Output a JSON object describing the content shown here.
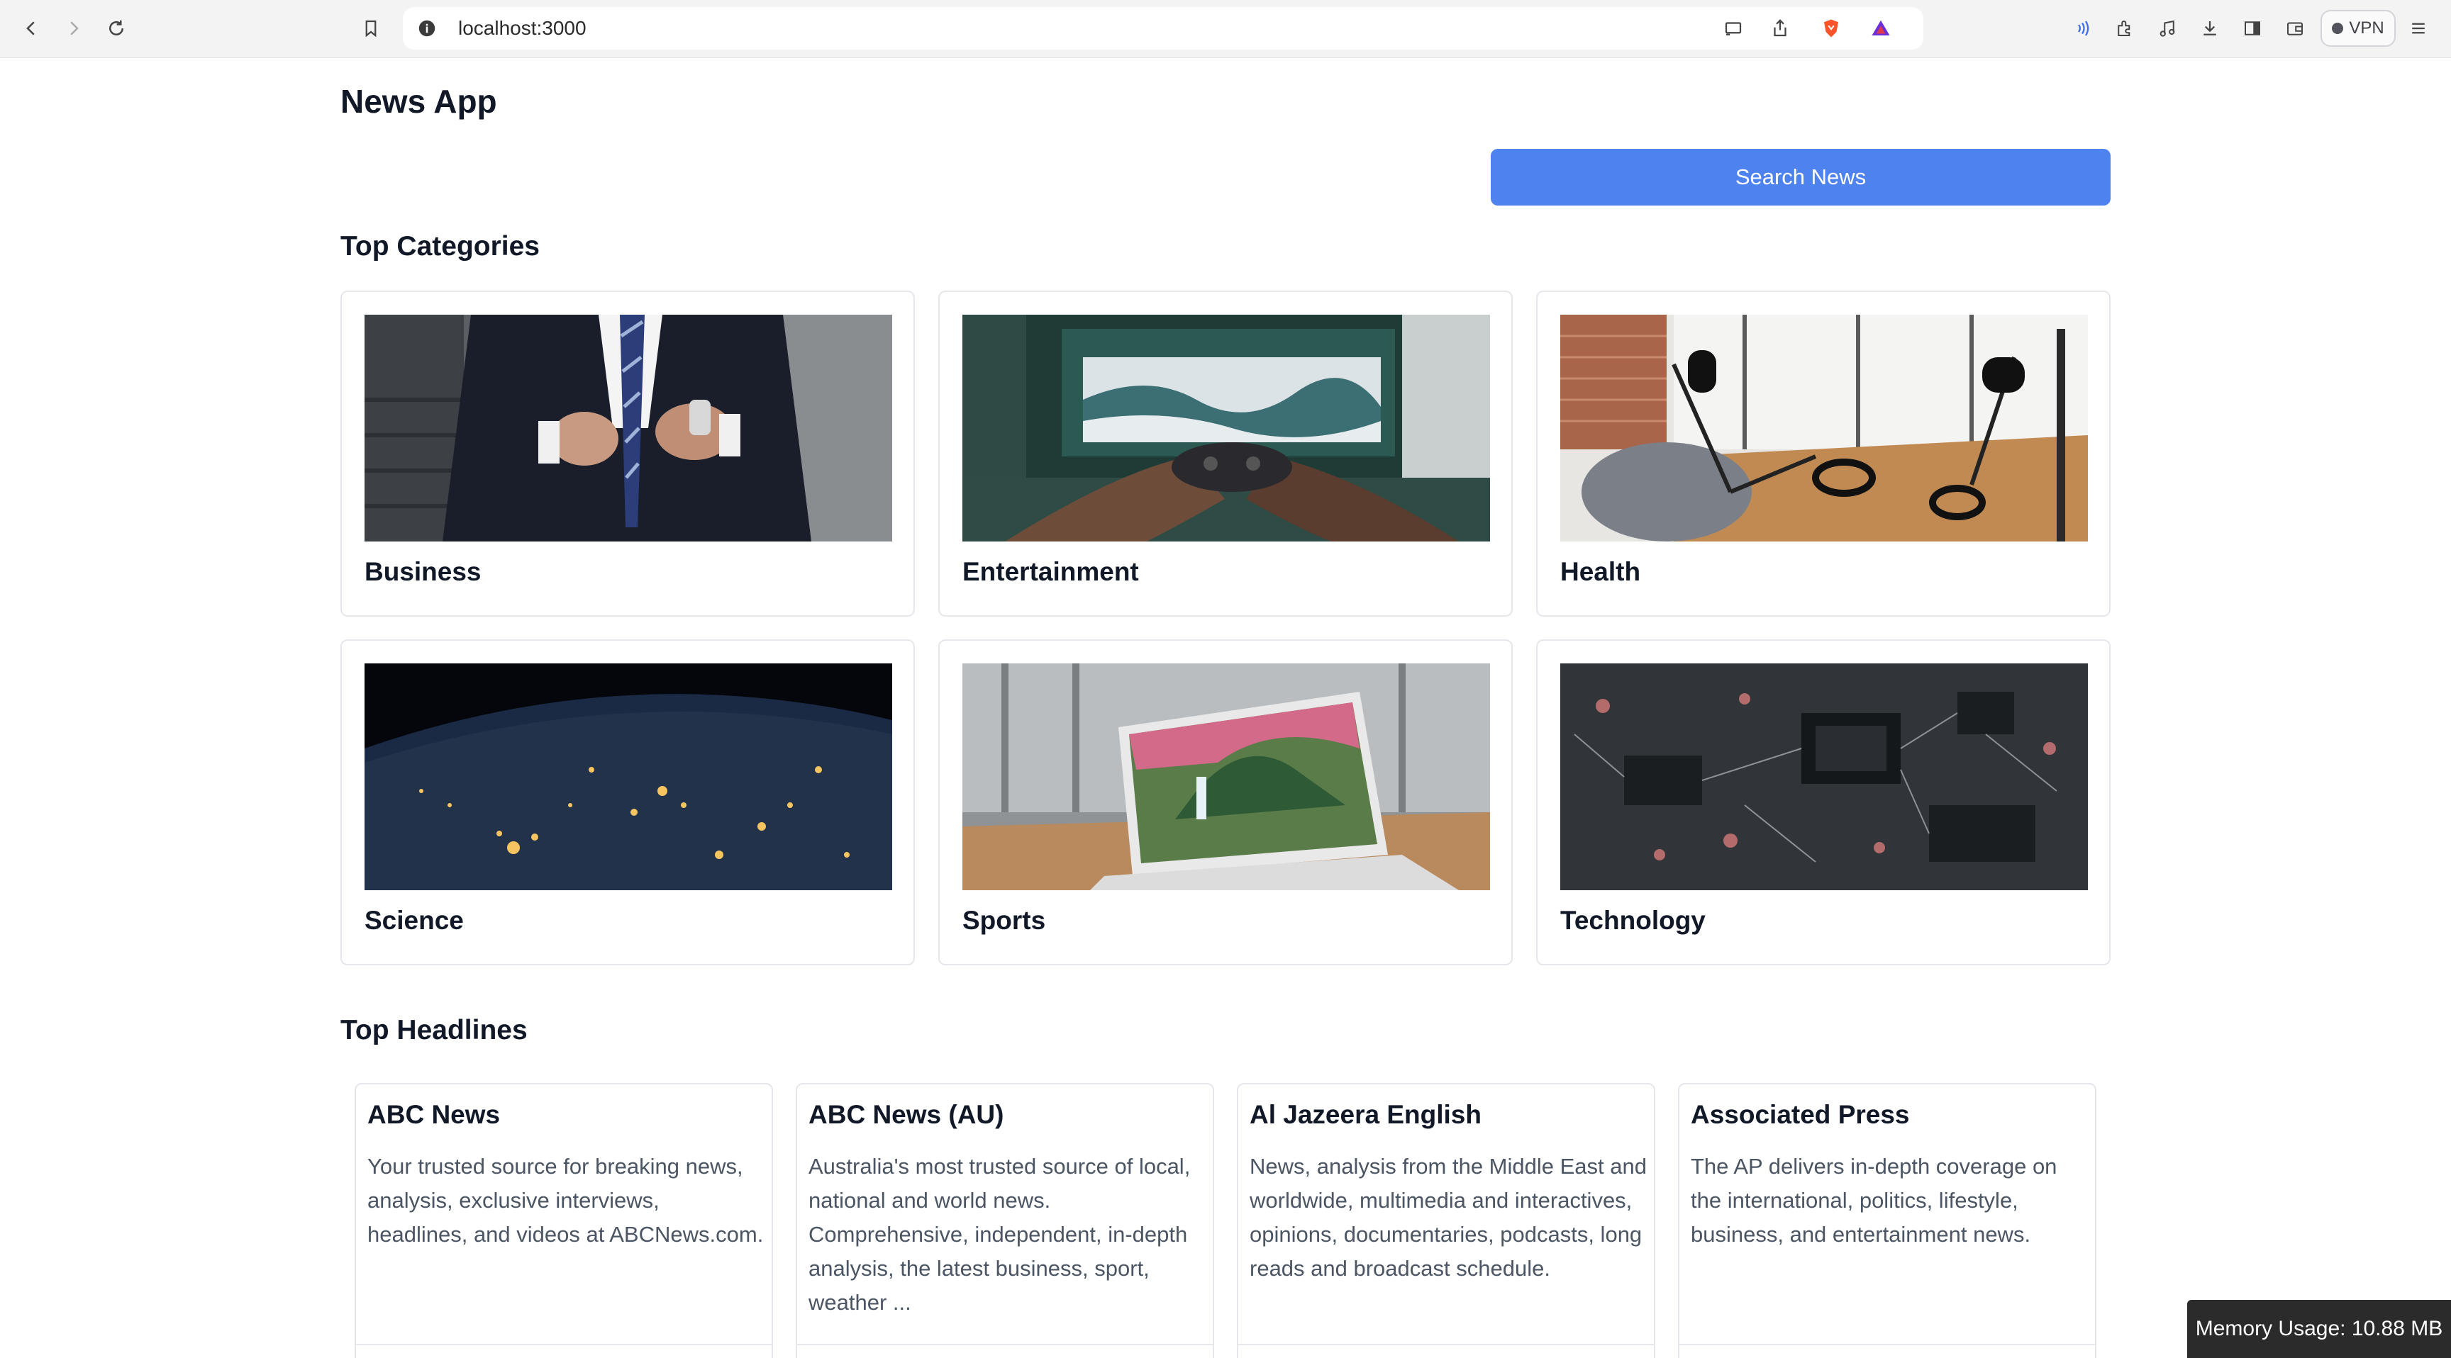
{
  "browser": {
    "url": "localhost:3000",
    "vpn_label": "VPN"
  },
  "header": {
    "title": "News App",
    "search_button_label": "Search News"
  },
  "categories_section": {
    "title": "Top Categories",
    "items": [
      {
        "label": "Business"
      },
      {
        "label": "Entertainment"
      },
      {
        "label": "Health"
      },
      {
        "label": "Science"
      },
      {
        "label": "Sports"
      },
      {
        "label": "Technology"
      }
    ]
  },
  "headlines_section": {
    "title": "Top Headlines",
    "items": [
      {
        "source": "ABC News",
        "description": "Your trusted source for breaking news, analysis, exclusive interviews, headlines, and videos at ABCNews.com."
      },
      {
        "source": "ABC News (AU)",
        "description": "Australia's most trusted source of local, national and world news. Comprehensive, independent, in-depth analysis, the latest business, sport, weather ..."
      },
      {
        "source": "Al Jazeera English",
        "description": "News, analysis from the Middle East and worldwide, multimedia and interactives, opinions, documentaries, podcasts, long reads and broadcast schedule."
      },
      {
        "source": "Associated Press",
        "description": "The AP delivers in-depth coverage on the international, politics, lifestyle, business, and entertainment news."
      }
    ]
  },
  "status": {
    "memory_usage": "Memory Usage: 10.88 MB"
  }
}
